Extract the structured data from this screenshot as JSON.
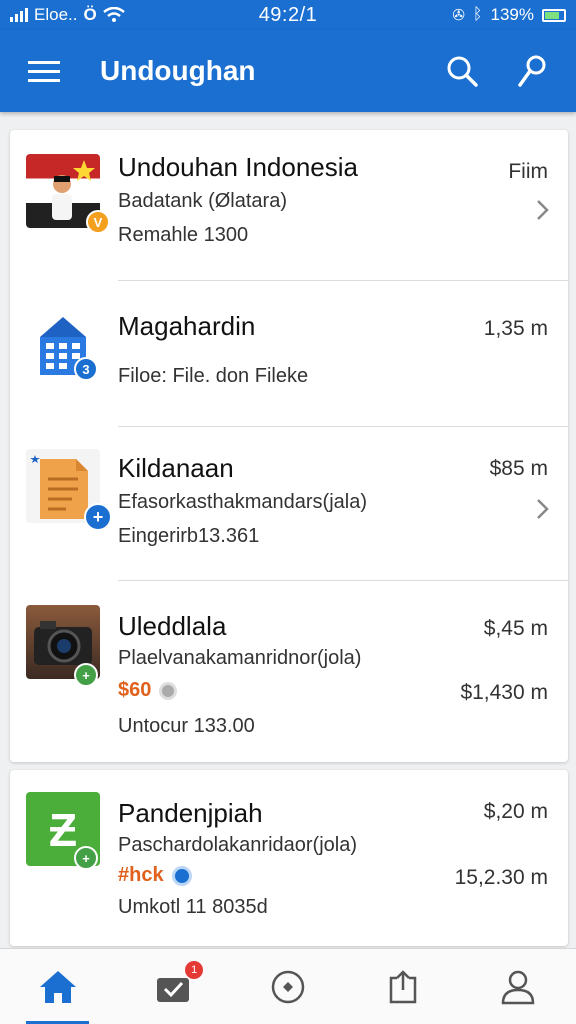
{
  "status_bar": {
    "carrier": "Eloe..",
    "time": "49:2/1",
    "battery": "139%"
  },
  "app_bar": {
    "title": "Undoughan"
  },
  "items": [
    {
      "name": "Undouhan Indonesia",
      "subtitle": "Badatank (Ølatara)",
      "meta": "Remahle 1300",
      "right": "Fiim",
      "badge": "V",
      "badge_color": "#f2a01e"
    },
    {
      "name": "Magahardin",
      "subtitle": "Filoe: File. don Fileke",
      "right": "1,35 m",
      "badge": "3",
      "badge_color": "#1a6fd1"
    },
    {
      "name": "Kildanaan",
      "subtitle": "Efasorkasthakmandars(jala)",
      "meta": "Eingerirb13.361",
      "right": "$85 m",
      "badge": "+",
      "badge_color": "#1a6fd1"
    },
    {
      "name": "Uleddlala",
      "subtitle": "Plaelvanakamanridnor(jola)",
      "price": "$60",
      "meta": "Untocur 133.00",
      "right": "$,45 m",
      "right2": "$1,430 m",
      "badge": "+",
      "badge_color": "#43a047"
    },
    {
      "name": "Pandenjpiah",
      "subtitle": "Paschardolakanridaor(jola)",
      "price": "#hck",
      "meta": "Umkotl 11 8035d",
      "right": "$,20 m",
      "right2": "15,2.30 m",
      "badge": "+",
      "badge_color": "#43a047"
    }
  ],
  "bottom_nav": {
    "notification_count": "1"
  },
  "colors": {
    "primary": "#1a6fd1",
    "price": "#e0611b",
    "green": "#43a047"
  }
}
